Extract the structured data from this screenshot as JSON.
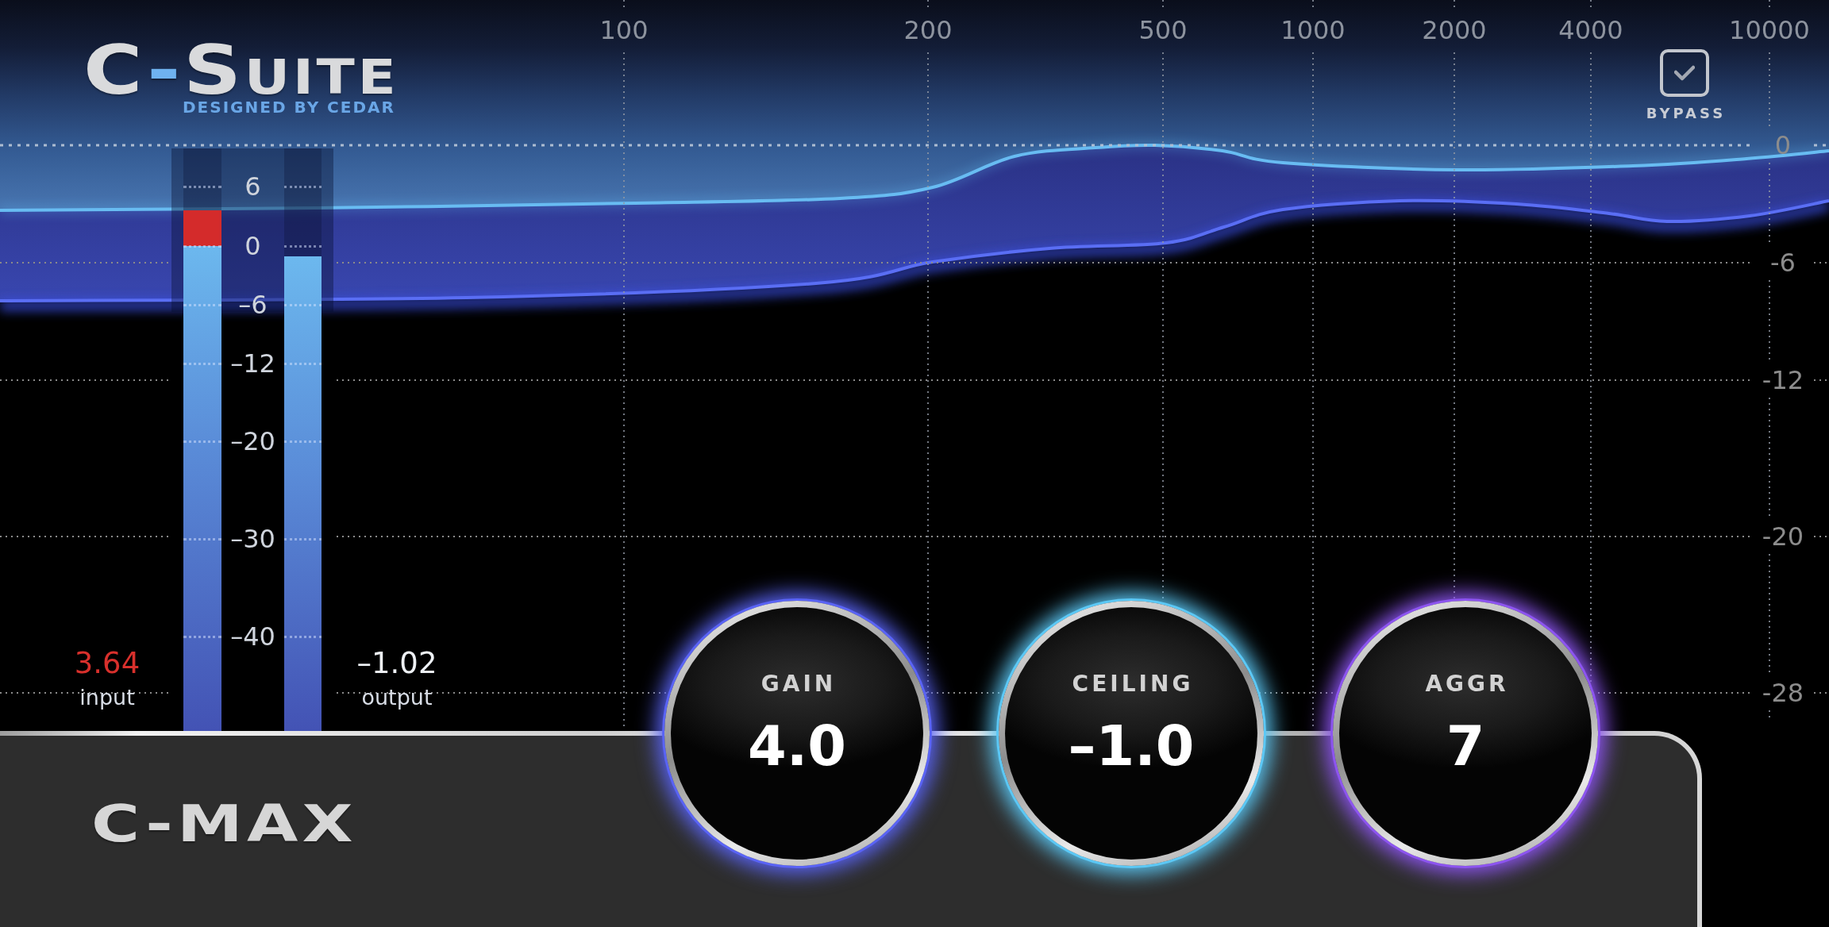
{
  "logo": {
    "name": "C-Suite",
    "tagline": "DESIGNED BY CEDAR"
  },
  "bypass": {
    "label": "BYPASS",
    "checked": true
  },
  "display": {
    "frequency_labels": [
      "100",
      "200",
      "500",
      "1000",
      "2000",
      "4000",
      "10000"
    ],
    "level_labels": [
      "0",
      "-6",
      "-12",
      "-20",
      "-28"
    ]
  },
  "meters": {
    "scale": [
      "6",
      "0",
      "–6",
      "–12",
      "–20",
      "–30",
      "–40"
    ],
    "channels": [
      {
        "name": "input",
        "reading": "3.64",
        "level": 0.894,
        "clipping": true
      },
      {
        "name": "output",
        "reading": "–1.02",
        "level": 0.816,
        "clipping": false
      }
    ]
  },
  "panel": {
    "title": "C-MAX",
    "knobs": [
      {
        "label": "GAIN",
        "value": "4.0",
        "color": "#5a64f5"
      },
      {
        "label": "CEILING",
        "value": "–1.0",
        "color": "#5cc8f5"
      },
      {
        "label": "AGGR",
        "value": "7",
        "color": "#8d55f0"
      }
    ]
  }
}
